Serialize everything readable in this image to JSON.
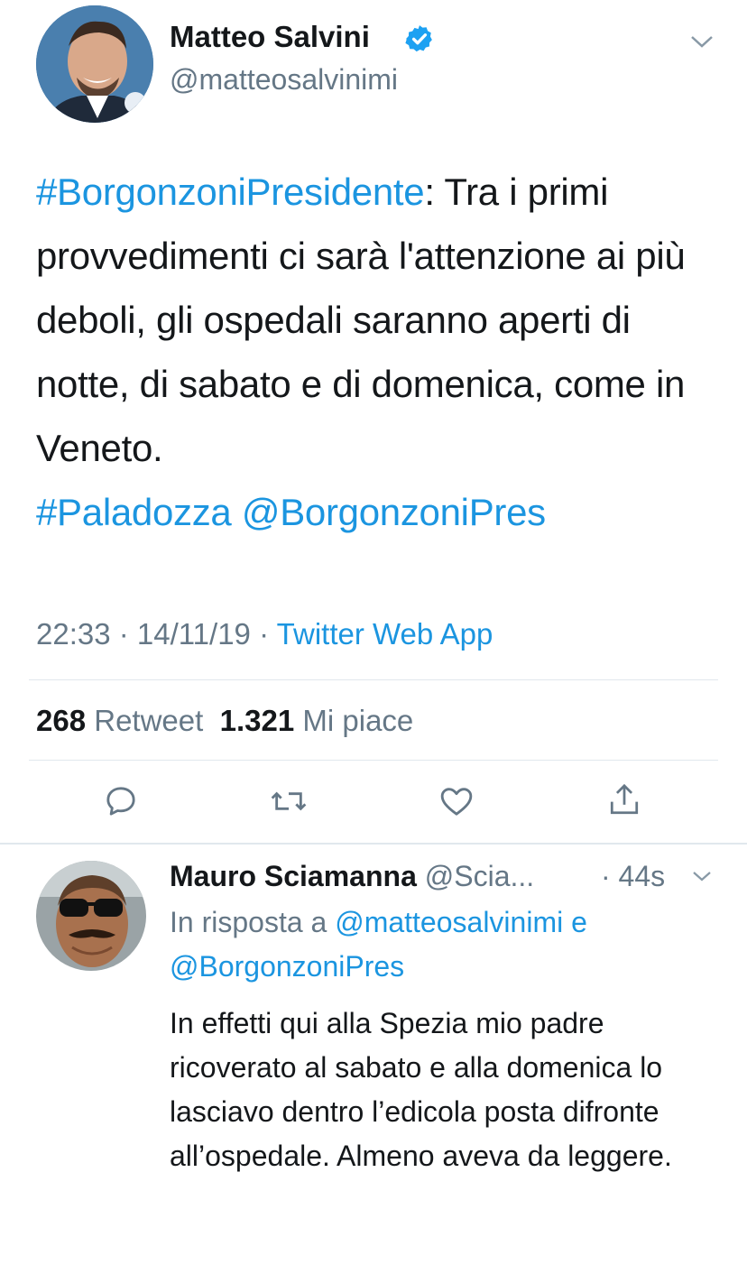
{
  "tweet": {
    "author_name": "Matteo Salvini",
    "author_handle": "@matteosalvinimi",
    "hashtag1": "#BorgonzoniPresidente",
    "body": ": Tra i primi provvedimenti ci sarà l'attenzione ai più deboli, gli ospedali saranno aperti di notte, di sabato e di domenica, come in Veneto.",
    "hashtag2": "#Paladozza",
    "mention": "@BorgonzoniPres",
    "timestamp": "22:33 · 14/11/19 · ",
    "source": "Twitter Web App",
    "retweet_count": "268",
    "retweet_label": "Retweet",
    "like_count": "1.321",
    "like_label": "Mi piace"
  },
  "reply": {
    "author_name": "Mauro Sciamanna",
    "author_handle": "@Scia...",
    "time": "· 44s",
    "in_reply_prefix": "In risposta a ",
    "in_reply_mention1": "@matteosalvinimi",
    "in_reply_and": " e",
    "in_reply_mention2": "@BorgonzoniPres",
    "body": "In effetti qui alla Spezia mio padre ricoverato al sabato e alla domenica lo lasciavo dentro l’edicola posta difronte all’ospedale. Almeno aveva da leggere."
  },
  "colors": {
    "link": "#1b95e0",
    "secondary": "#657786",
    "divider": "#e1e8ed",
    "verified": "#1da1f2"
  },
  "icons": [
    "verified-badge-icon",
    "chevron-down-icon",
    "reply-icon",
    "retweet-icon",
    "like-icon",
    "share-icon"
  ]
}
